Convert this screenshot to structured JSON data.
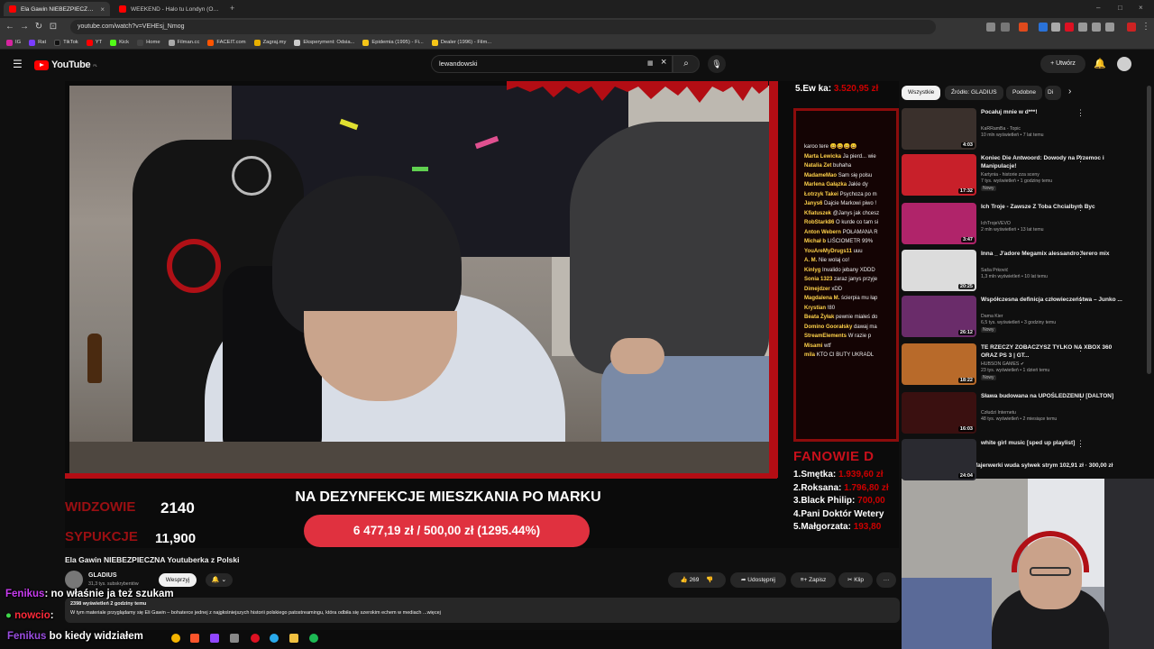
{
  "browser": {
    "tabs": [
      {
        "label": "Ela Gawin NIEBEZPIECZNA Yo",
        "active": true
      },
      {
        "label": "WEEKEND - Halo tu Londyn (Oficjaln",
        "active": false
      }
    ],
    "url": "youtube.com/watch?v=VEHEsj_Nmog",
    "bookmarks": [
      "IG",
      "Rat",
      "TikTok",
      "YT",
      "Kick",
      "Home",
      "Filman.cc",
      "FACEIT.com",
      "Zagraj.my",
      "Eksperyment: Odsia...",
      "Epidemia (1995) - Fi...",
      "Dealer (1996) - Film..."
    ]
  },
  "youtube": {
    "logo_text": "YouTube",
    "logo_region": "PL",
    "search_value": "lewandowski",
    "create_label": "Utwórz"
  },
  "stream": {
    "top_donor_label": "5.Ew ka:",
    "top_donor_amount": "3.520,95 zł",
    "chat_lines": [
      {
        "user": "",
        "msg": "karoo tere 😀😀😀😀"
      },
      {
        "user": "Marta Lewicka",
        "msg": "Ja pierd... wie"
      },
      {
        "user": "Natalia Zet",
        "msg": "buhaha"
      },
      {
        "user": "MadameMao",
        "msg": "Sam się polsu"
      },
      {
        "user": "Marlena Gałązka",
        "msg": "Jakie dy"
      },
      {
        "user": "Łotrzyk Takei",
        "msg": "Psychoza po m"
      },
      {
        "user": "Janys6",
        "msg": "Dajcie Markowi piwo !"
      },
      {
        "user": "Kfiatuszek",
        "msg": "@Janys jak chcesz"
      },
      {
        "user": "RobStark86",
        "msg": "O kurde co tam si"
      },
      {
        "user": "Anton Webern",
        "msg": "POŁAMANA R"
      },
      {
        "user": "Michał b",
        "msg": "LIŚCIOMETR 99%"
      },
      {
        "user": "YouAreMyDrugs11",
        "msg": "uuu"
      },
      {
        "user": "A. M.",
        "msg": "Nie wolaj co!"
      },
      {
        "user": "Kinlyg",
        "msg": "Invalido jebany XDDD"
      },
      {
        "user": "Sonia 1323",
        "msg": "zaraz janys przyje"
      },
      {
        "user": "Dimejdzer",
        "msg": "xDD"
      },
      {
        "user": "Magdalena M.",
        "msg": "ścierpia mu łap"
      },
      {
        "user": "Krystian",
        "msg": "!80"
      },
      {
        "user": "Beata Żyłak",
        "msg": "pewnie miałeś do"
      },
      {
        "user": "Domino Goorałsky",
        "msg": "dawaj ma"
      },
      {
        "user": "StreamElements",
        "msg": "W razie p"
      },
      {
        "user": "Misami",
        "msg": "wtf"
      },
      {
        "user": "mila",
        "msg": "KTO CI BUTY UKRADL"
      }
    ],
    "fans_title": "FANOWIE D",
    "fans": [
      {
        "name": "1.Smętka:",
        "amount": "1.939,60 zł"
      },
      {
        "name": "2.Roksana:",
        "amount": "1.796,80 zł"
      },
      {
        "name": "3.Black Philip:",
        "amount": "700,00"
      },
      {
        "name": "4.Pani Doktór Wetery",
        "amount": ""
      },
      {
        "name": "5.Małgorzata:",
        "amount": "193,80"
      }
    ],
    "viewers_label": "WIDZOWIE",
    "viewers_value": "2140",
    "subs_label": "SYPUKCJE",
    "subs_value": "11,900",
    "goal_title": "NA DEZYNFEKCJE MIESZKANIA PO MARKU",
    "goal_progress_text": "6 477,19 zł / 500,00 zł (1295.44%)"
  },
  "video": {
    "title": "Ela Gawin NIEBEZPIECZNA Youtuberka z Polski",
    "channel": "GLADIUS",
    "subscribers": "31,3 tys. subskrybentów",
    "subscribe_label": "Wesprzyj",
    "bell_label": "🔔 ⌄",
    "likes": "269",
    "share_label": "Udostępnij",
    "save_label": "Zapisz",
    "clip_label": "Klip",
    "more_label": "···",
    "views_line": "2398 wyświetleń  2 godziny temu",
    "description": "W tym materiale przyglądamy się Eli Gawin – bohaterce jednej z najgłośniejszych historii polskiego patostreamingu, która odbiła się szerokim echem w mediach ...więcej"
  },
  "overlay_chat": [
    {
      "name": "Fenikus",
      "msg": ": no właśnie ja też szukam"
    },
    {
      "name": "nowcio",
      "msg": ":"
    },
    {
      "name": "Fenikus",
      "msg": "bo kiedy widziałem"
    }
  ],
  "sidebar": {
    "chips": [
      {
        "label": "Wszystkie",
        "active": true
      },
      {
        "label": "Źródło: GLADIUS",
        "active": false
      },
      {
        "label": "Podobne",
        "active": false
      },
      {
        "label": "Di",
        "active": false
      }
    ],
    "recommendations": [
      {
        "title": "Pocałuj mnie w d***!",
        "channel": "KaRRamBa - Topic",
        "meta": "10 mln wyświetleń • 7 lat temu",
        "duration": "4:03",
        "new": "",
        "bg": "#3a302c"
      },
      {
        "title": "Koniec Die Antwoord: Dowody na Przemoc i Manipulacje!",
        "channel": "Kartynia - historie zza sceny",
        "meta": "7 tys. wyświetleń • 1 godzinę temu",
        "duration": "17:32",
        "new": "Nowy",
        "bg": "#c8202a"
      },
      {
        "title": "Ich Troje - Zawsze Z Toba Chcialbym Byc",
        "channel": "IchTrojeVEVO",
        "meta": "2 mln wyświetleń • 13 lat temu",
        "duration": "3:47",
        "new": "",
        "bg": "#b0246a"
      },
      {
        "title": "Inna _ J'adore Megamix alessandro ferero mix",
        "channel": "Saša Prković",
        "meta": "1,3 mln wyświetleń • 10 lat temu",
        "duration": "20:25",
        "new": "",
        "bg": "#dcdcdc"
      },
      {
        "title": "Współczesna definicja człowieczeństwa – Junko ...",
        "channel": "Dama Kier",
        "meta": "6,5 tys. wyświetleń • 3 godziny temu",
        "duration": "26:12",
        "new": "Nowy",
        "bg": "#6a2c6a"
      },
      {
        "title": "TE RZECZY ZOBACZYSZ TYLKO NA XBOX 360 ORAZ PS 3 | GT...",
        "channel": "HUBSON GAMES ✔",
        "meta": "23 tys. wyświetleń • 1 dzień temu",
        "duration": "18:22",
        "new": "Nowy",
        "bg": "#b86a2a"
      },
      {
        "title": "Sława budowana na UPOŚLEDZENIU [DALTON]",
        "channel": "Człudzi Internetu",
        "meta": "48 tys. wyświetleń • 2 miesiące temu",
        "duration": "16:03",
        "new": "",
        "bg": "#3a1010"
      },
      {
        "title": "white girl music [sped up playlist]",
        "channel": "",
        "meta": "",
        "duration": "24:04",
        "new": "",
        "bg": "#2a2a30"
      }
    ],
    "ticker": "fajerwerki wuda sylwek strym  102,91 zł  ·  300,00 zł"
  }
}
